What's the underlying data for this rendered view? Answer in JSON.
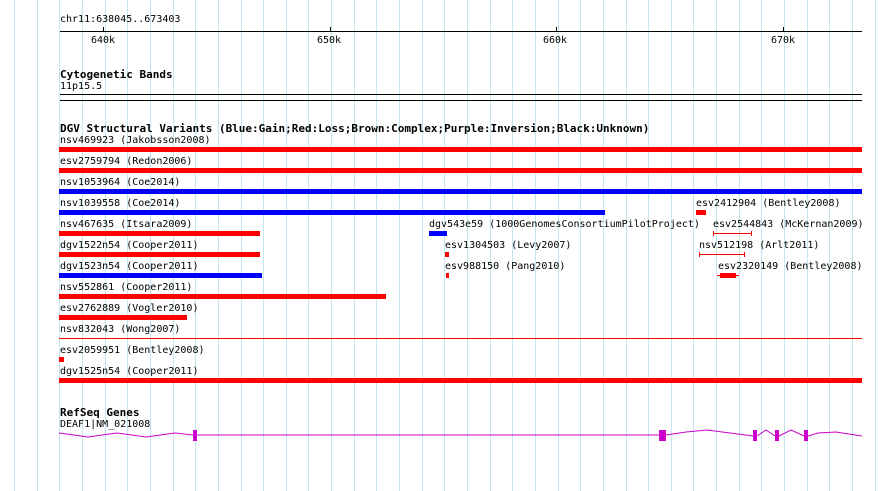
{
  "ruler": {
    "region": "chr11:638045..673403",
    "ticks": [
      "640k",
      "650k",
      "660k",
      "670k"
    ]
  },
  "cytoband": {
    "title": "Cytogenetic Bands",
    "band": "11p15.5"
  },
  "dgv": {
    "title": "DGV Structural Variants (Blue:Gain;Red:Loss;Brown:Complex;Purple:Inversion;Black:Unknown)",
    "colors": {
      "gain": "#0000ff",
      "loss": "#ff0000"
    },
    "variants": [
      "nsv469923 (Jakobsson2008)",
      "esv2759794 (Redon2006)",
      "nsv1053964 (Coe2014)",
      "nsv1039558 (Coe2014)",
      "esv2412904 (Bentley2008)",
      "nsv467635 (Itsara2009)",
      "dgv543e59 (1000GenomesConsortiumPilotProject)",
      "esv2544843 (McKernan2009)",
      "dgv1522n54 (Cooper2011)",
      "esv1304503 (Levy2007)",
      "nsv512198 (Arlt2011)",
      "dgv1523n54 (Cooper2011)",
      "esv988150 (Pang2010)",
      "esv2320149 (Bentley2008)",
      "nsv552861 (Cooper2011)",
      "esv2762889 (Vogler2010)",
      "nsv832043 (Wong2007)",
      "esv2059951 (Bentley2008)",
      "dgv1525n54 (Cooper2011)"
    ]
  },
  "refseq": {
    "title": "RefSeq Genes",
    "gene": "DEAF1|NM_021008",
    "color": "#cc00cc"
  }
}
